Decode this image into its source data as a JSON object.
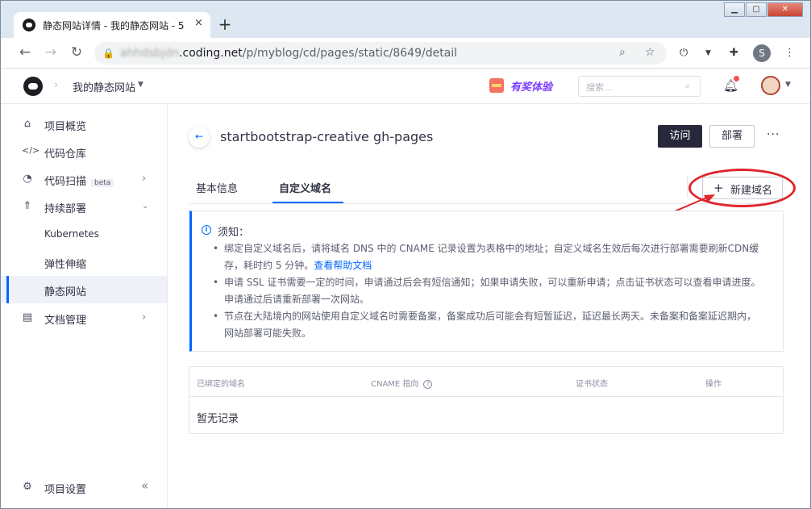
{
  "browser": {
    "tab_title": "静态网站详情 - 我的静态网站 - 5",
    "tab_close": "×",
    "new_tab": "+",
    "url_blur": "ahhdsbjdn",
    "url_host": ".coding.net",
    "url_path": "/p/myblog/cd/pages/static/8649/detail",
    "profile_initial": "S"
  },
  "header": {
    "project_name": "我的静态网站",
    "promo_text": "有奖体验",
    "search_placeholder": "搜索..."
  },
  "sidebar": {
    "items": [
      {
        "label": "项目概览",
        "icon": "home-icon"
      },
      {
        "label": "代码仓库",
        "icon": "code-icon"
      },
      {
        "label": "代码扫描",
        "icon": "scan-icon",
        "badge": "beta"
      },
      {
        "label": "持续部署",
        "icon": "rocket-icon"
      },
      {
        "label": "Kubernetes"
      },
      {
        "label": "弹性伸缩"
      },
      {
        "label": "静态网站"
      },
      {
        "label": "文档管理",
        "icon": "document-icon"
      }
    ],
    "footer_label": "项目设置"
  },
  "page": {
    "title": "startbootstrap-creative gh-pages",
    "visit_button": "访问",
    "deploy_button": "部署",
    "tabs": [
      "基本信息",
      "自定义域名"
    ],
    "new_domain_button": "新建域名"
  },
  "notice": {
    "heading": "须知：",
    "points": [
      {
        "l1": "绑定自定义域名后，请将域名 DNS 中的 CNAME 记录设置为表格中的地址；自定义域名生效后每次进行部署需要刷新CDN缓",
        "l2": "存，耗时约 5 分钟。",
        "link": "查看帮助文档"
      },
      {
        "l1": "申请 SSL 证书需要一定的时间，申请通过后会有短信通知；如果申请失败，可以重新申请；点击证书状态可以查看申请进度。",
        "l2": "申请通过后请重新部署一次网站。"
      },
      {
        "l1": "节点在大陆境内的网站使用自定义域名时需要备案，备案成功后可能会有短暂延迟，延迟最长两天。未备案和备案延迟期内，",
        "l2": "网站部署可能失败。"
      }
    ]
  },
  "table": {
    "columns": [
      "已绑定的域名",
      "CNAME 指向",
      "证书状态",
      "操作"
    ],
    "empty_text": "暂无记录"
  },
  "colors": {
    "accent": "#0066ff",
    "annotation_red": "#e0242a",
    "primary_button": "#27283a"
  }
}
